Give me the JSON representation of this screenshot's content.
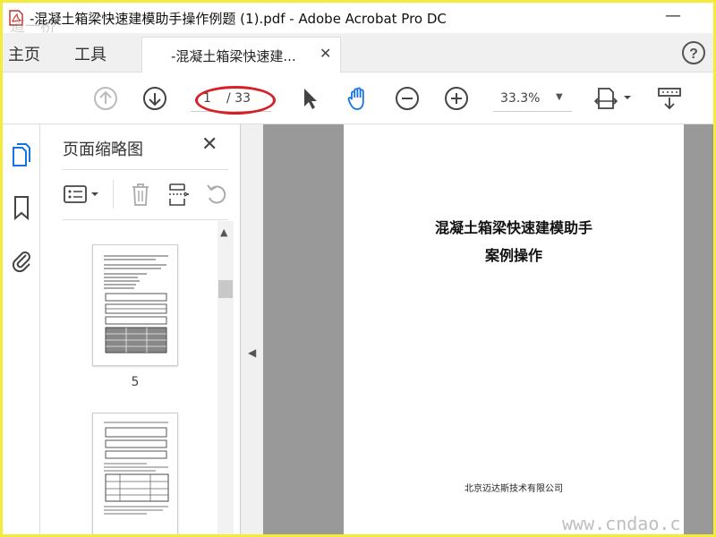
{
  "window": {
    "title": "-混凝土箱梁快速建模助手操作例题 (1).pdf - Adobe Acrobat Pro DC",
    "minimize_glyph": "—",
    "watermark_top": "道一桥",
    "watermark_bottom": "www.cndao.c"
  },
  "tabs": {
    "home": "主页",
    "tools": "工具",
    "document_tab": "-混凝土箱梁快速建...",
    "close_glyph": "✕",
    "help_glyph": "?"
  },
  "toolbar": {
    "page_current": "1",
    "page_total": "/ 33",
    "zoom": "33.3%",
    "zoom_caret": "▼",
    "icons": [
      "arrow-up-circle-icon",
      "arrow-down-circle-icon",
      "pointer-icon",
      "hand-icon",
      "zoom-out-icon",
      "zoom-in-icon",
      "fit-page-icon",
      "scroll-mode-icon"
    ],
    "annotation_color": "#d81f26"
  },
  "panel": {
    "title": "页面缩略图",
    "close_glyph": "✕",
    "thumbnails": [
      {
        "label": "5"
      },
      {
        "label": ""
      }
    ]
  },
  "document": {
    "title_line1": "混凝土箱梁快速建模助手",
    "title_line2": "案例操作",
    "company": "北京迈达斯技术有限公司"
  },
  "colors": {
    "frame_border": "#f3ec3c",
    "icon_gray": "#9a9a9a",
    "icon_dark": "#444444",
    "icon_blue": "#1473e6",
    "gutter": "#999999"
  }
}
